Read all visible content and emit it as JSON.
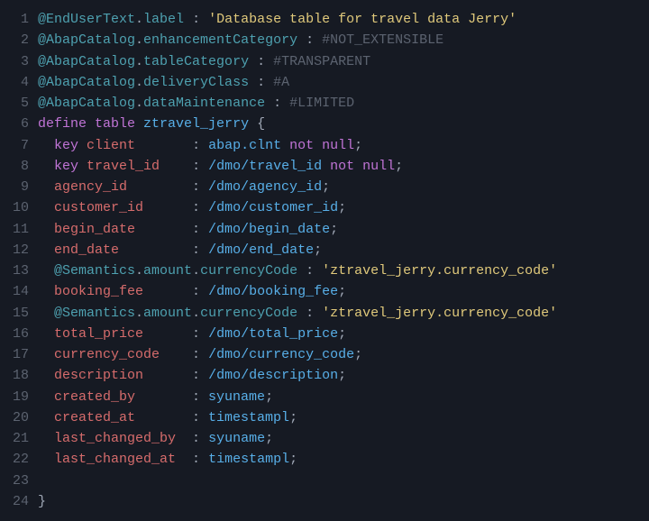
{
  "lines": [
    {
      "n": "1",
      "tokens": [
        {
          "c": "anno",
          "t": "@EndUserText"
        },
        {
          "c": "dot",
          "t": "."
        },
        {
          "c": "anno",
          "t": "label"
        },
        {
          "c": "punct",
          "t": " : "
        },
        {
          "c": "str",
          "t": "'Database table for travel data Jerry'"
        }
      ]
    },
    {
      "n": "2",
      "tokens": [
        {
          "c": "anno",
          "t": "@AbapCatalog"
        },
        {
          "c": "dot",
          "t": "."
        },
        {
          "c": "anno",
          "t": "enhancementCategory"
        },
        {
          "c": "punct",
          "t": " : "
        },
        {
          "c": "cmt",
          "t": "#NOT_EXTENSIBLE"
        }
      ]
    },
    {
      "n": "3",
      "tokens": [
        {
          "c": "anno",
          "t": "@AbapCatalog"
        },
        {
          "c": "dot",
          "t": "."
        },
        {
          "c": "anno",
          "t": "tableCategory"
        },
        {
          "c": "punct",
          "t": " : "
        },
        {
          "c": "cmt",
          "t": "#TRANSPARENT"
        }
      ]
    },
    {
      "n": "4",
      "tokens": [
        {
          "c": "anno",
          "t": "@AbapCatalog"
        },
        {
          "c": "dot",
          "t": "."
        },
        {
          "c": "anno",
          "t": "deliveryClass"
        },
        {
          "c": "punct",
          "t": " : "
        },
        {
          "c": "cmt",
          "t": "#A"
        }
      ]
    },
    {
      "n": "5",
      "tokens": [
        {
          "c": "anno",
          "t": "@AbapCatalog"
        },
        {
          "c": "dot",
          "t": "."
        },
        {
          "c": "anno",
          "t": "dataMaintenance"
        },
        {
          "c": "punct",
          "t": " : "
        },
        {
          "c": "cmt",
          "t": "#LIMITED"
        }
      ]
    },
    {
      "n": "6",
      "tokens": [
        {
          "c": "kw",
          "t": "define table"
        },
        {
          "c": "punct",
          "t": " "
        },
        {
          "c": "type",
          "t": "ztravel_jerry"
        },
        {
          "c": "punct",
          "t": " {"
        }
      ]
    },
    {
      "n": "7",
      "tokens": [
        {
          "c": "punct",
          "t": "  "
        },
        {
          "c": "key",
          "t": "key"
        },
        {
          "c": "punct",
          "t": " "
        },
        {
          "c": "field",
          "t": "client"
        },
        {
          "c": "punct",
          "t": "       : "
        },
        {
          "c": "type",
          "t": "abap.clnt"
        },
        {
          "c": "punct",
          "t": " "
        },
        {
          "c": "kw",
          "t": "not null"
        },
        {
          "c": "punct",
          "t": ";"
        }
      ]
    },
    {
      "n": "8",
      "tokens": [
        {
          "c": "punct",
          "t": "  "
        },
        {
          "c": "key",
          "t": "key"
        },
        {
          "c": "punct",
          "t": " "
        },
        {
          "c": "field",
          "t": "travel_id"
        },
        {
          "c": "punct",
          "t": "    : "
        },
        {
          "c": "type",
          "t": "/dmo/travel_id"
        },
        {
          "c": "punct",
          "t": " "
        },
        {
          "c": "kw",
          "t": "not null"
        },
        {
          "c": "punct",
          "t": ";"
        }
      ]
    },
    {
      "n": "9",
      "tokens": [
        {
          "c": "punct",
          "t": "  "
        },
        {
          "c": "field",
          "t": "agency_id"
        },
        {
          "c": "punct",
          "t": "        : "
        },
        {
          "c": "type",
          "t": "/dmo/agency_id"
        },
        {
          "c": "punct",
          "t": ";"
        }
      ]
    },
    {
      "n": "10",
      "tokens": [
        {
          "c": "punct",
          "t": "  "
        },
        {
          "c": "field",
          "t": "customer_id"
        },
        {
          "c": "punct",
          "t": "      : "
        },
        {
          "c": "type",
          "t": "/dmo/customer_id"
        },
        {
          "c": "punct",
          "t": ";"
        }
      ]
    },
    {
      "n": "11",
      "tokens": [
        {
          "c": "punct",
          "t": "  "
        },
        {
          "c": "field",
          "t": "begin_date"
        },
        {
          "c": "punct",
          "t": "       : "
        },
        {
          "c": "type",
          "t": "/dmo/begin_date"
        },
        {
          "c": "punct",
          "t": ";"
        }
      ]
    },
    {
      "n": "12",
      "tokens": [
        {
          "c": "punct",
          "t": "  "
        },
        {
          "c": "field",
          "t": "end_date"
        },
        {
          "c": "punct",
          "t": "         : "
        },
        {
          "c": "type",
          "t": "/dmo/end_date"
        },
        {
          "c": "punct",
          "t": ";"
        }
      ]
    },
    {
      "n": "13",
      "tokens": [
        {
          "c": "punct",
          "t": "  "
        },
        {
          "c": "anno",
          "t": "@Semantics"
        },
        {
          "c": "dot",
          "t": "."
        },
        {
          "c": "anno",
          "t": "amount"
        },
        {
          "c": "dot",
          "t": "."
        },
        {
          "c": "anno",
          "t": "currencyCode"
        },
        {
          "c": "punct",
          "t": " : "
        },
        {
          "c": "str",
          "t": "'ztravel_jerry.currency_code'"
        }
      ]
    },
    {
      "n": "14",
      "tokens": [
        {
          "c": "punct",
          "t": "  "
        },
        {
          "c": "field",
          "t": "booking_fee"
        },
        {
          "c": "punct",
          "t": "      : "
        },
        {
          "c": "type",
          "t": "/dmo/booking_fee"
        },
        {
          "c": "punct",
          "t": ";"
        }
      ]
    },
    {
      "n": "15",
      "tokens": [
        {
          "c": "punct",
          "t": "  "
        },
        {
          "c": "anno",
          "t": "@Semantics"
        },
        {
          "c": "dot",
          "t": "."
        },
        {
          "c": "anno",
          "t": "amount"
        },
        {
          "c": "dot",
          "t": "."
        },
        {
          "c": "anno",
          "t": "currencyCode"
        },
        {
          "c": "punct",
          "t": " : "
        },
        {
          "c": "str",
          "t": "'ztravel_jerry.currency_code'"
        }
      ]
    },
    {
      "n": "16",
      "tokens": [
        {
          "c": "punct",
          "t": "  "
        },
        {
          "c": "field",
          "t": "total_price"
        },
        {
          "c": "punct",
          "t": "      : "
        },
        {
          "c": "type",
          "t": "/dmo/total_price"
        },
        {
          "c": "punct",
          "t": ";"
        }
      ]
    },
    {
      "n": "17",
      "tokens": [
        {
          "c": "punct",
          "t": "  "
        },
        {
          "c": "field",
          "t": "currency_code"
        },
        {
          "c": "punct",
          "t": "    : "
        },
        {
          "c": "type",
          "t": "/dmo/currency_code"
        },
        {
          "c": "punct",
          "t": ";"
        }
      ]
    },
    {
      "n": "18",
      "tokens": [
        {
          "c": "punct",
          "t": "  "
        },
        {
          "c": "field",
          "t": "description"
        },
        {
          "c": "punct",
          "t": "      : "
        },
        {
          "c": "type",
          "t": "/dmo/description"
        },
        {
          "c": "punct",
          "t": ";"
        }
      ]
    },
    {
      "n": "19",
      "tokens": [
        {
          "c": "punct",
          "t": "  "
        },
        {
          "c": "field",
          "t": "created_by"
        },
        {
          "c": "punct",
          "t": "       : "
        },
        {
          "c": "type",
          "t": "syuname"
        },
        {
          "c": "punct",
          "t": ";"
        }
      ]
    },
    {
      "n": "20",
      "tokens": [
        {
          "c": "punct",
          "t": "  "
        },
        {
          "c": "field",
          "t": "created_at"
        },
        {
          "c": "punct",
          "t": "       : "
        },
        {
          "c": "type",
          "t": "timestampl"
        },
        {
          "c": "punct",
          "t": ";"
        }
      ]
    },
    {
      "n": "21",
      "tokens": [
        {
          "c": "punct",
          "t": "  "
        },
        {
          "c": "field",
          "t": "last_changed_by"
        },
        {
          "c": "punct",
          "t": "  : "
        },
        {
          "c": "type",
          "t": "syuname"
        },
        {
          "c": "punct",
          "t": ";"
        }
      ]
    },
    {
      "n": "22",
      "tokens": [
        {
          "c": "punct",
          "t": "  "
        },
        {
          "c": "field",
          "t": "last_changed_at"
        },
        {
          "c": "punct",
          "t": "  : "
        },
        {
          "c": "type",
          "t": "timestampl"
        },
        {
          "c": "punct",
          "t": ";"
        }
      ]
    },
    {
      "n": "23",
      "tokens": []
    },
    {
      "n": "24",
      "tokens": [
        {
          "c": "punct",
          "t": "}"
        }
      ]
    }
  ]
}
